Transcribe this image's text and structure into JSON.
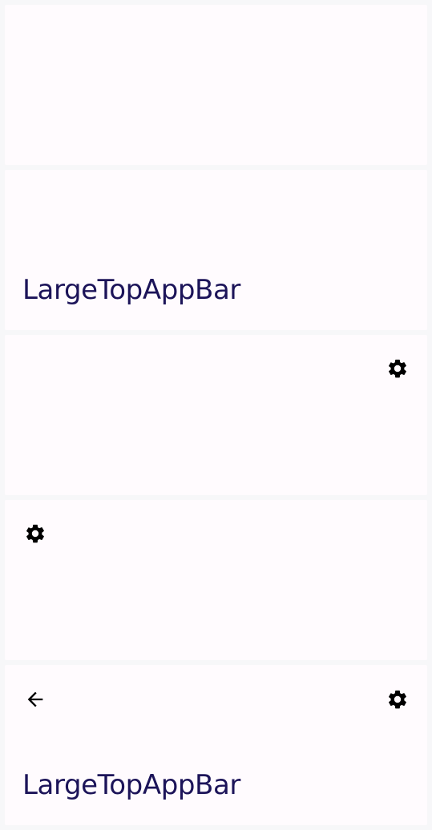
{
  "bars": [
    {
      "id": "bar-1"
    },
    {
      "id": "bar-2",
      "title": "LargeTopAppBar"
    },
    {
      "id": "bar-3",
      "action_icon": "settings-icon"
    },
    {
      "id": "bar-4",
      "navigation_icon": "settings-icon"
    },
    {
      "id": "bar-5",
      "navigation_icon": "arrow-back-icon",
      "action_icon": "settings-icon",
      "title": "LargeTopAppBar"
    }
  ],
  "colors": {
    "background": "#f7f7f9",
    "surface": "#fffbfe",
    "title_text": "#1c1459",
    "icon": "#000000"
  }
}
